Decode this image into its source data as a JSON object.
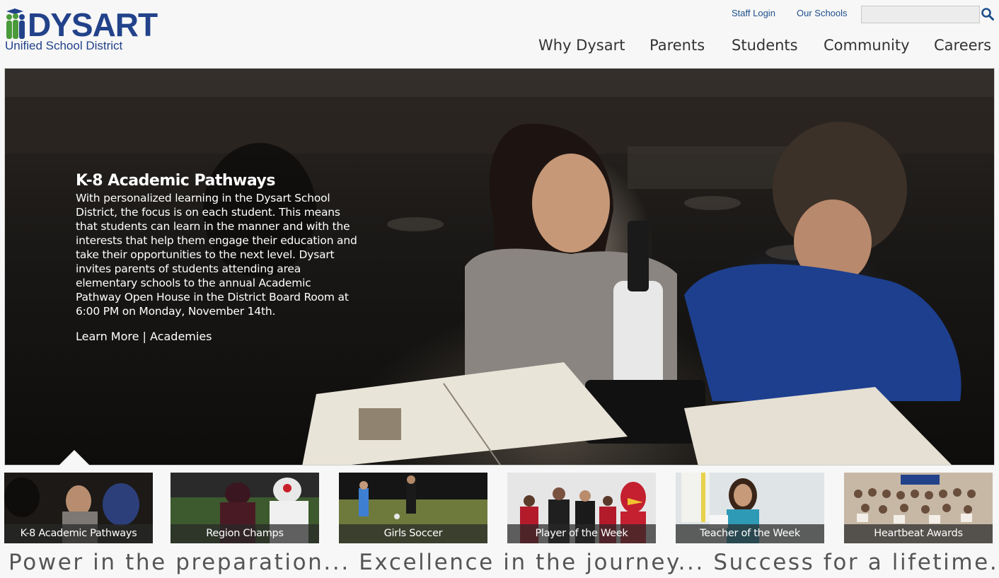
{
  "brand": {
    "name": "DYSART",
    "subtitle": "Unified School District",
    "colors": {
      "navy": "#22428a",
      "green": "#4a9a3a"
    }
  },
  "utility": {
    "staff_login": "Staff Login",
    "our_schools": "Our Schools",
    "search_placeholder": "",
    "search_icon": "magnifier-icon"
  },
  "nav": {
    "items": [
      {
        "label": "Why Dysart"
      },
      {
        "label": "Parents"
      },
      {
        "label": "Students"
      },
      {
        "label": "Community"
      },
      {
        "label": "Careers"
      }
    ]
  },
  "hero": {
    "title": "K-8 Academic Pathways",
    "body": "With personalized learning in the Dysart School District, the focus is on each student. This means that students can learn in the manner and with the interests that help them engage their education and take their opportunities to the next level. Dysart invites parents of students attending area elementary schools to the annual Academic Pathway Open House in the District Board Room at 6:00 PM on Monday, November 14th.",
    "link_learn_more": "Learn More",
    "link_separator": " | ",
    "link_academies": "Academies"
  },
  "slides": [
    {
      "label": "K-8 Academic Pathways",
      "active": true
    },
    {
      "label": "Region Champs",
      "active": false
    },
    {
      "label": "Girls Soccer",
      "active": false
    },
    {
      "label": "Player of the Week",
      "active": false
    },
    {
      "label": "Teacher of the Week",
      "active": false
    },
    {
      "label": "Heartbeat Awards",
      "active": false
    }
  ],
  "tagline": "Power in the preparation... Excellence in the journey... Success for a lifetime..."
}
